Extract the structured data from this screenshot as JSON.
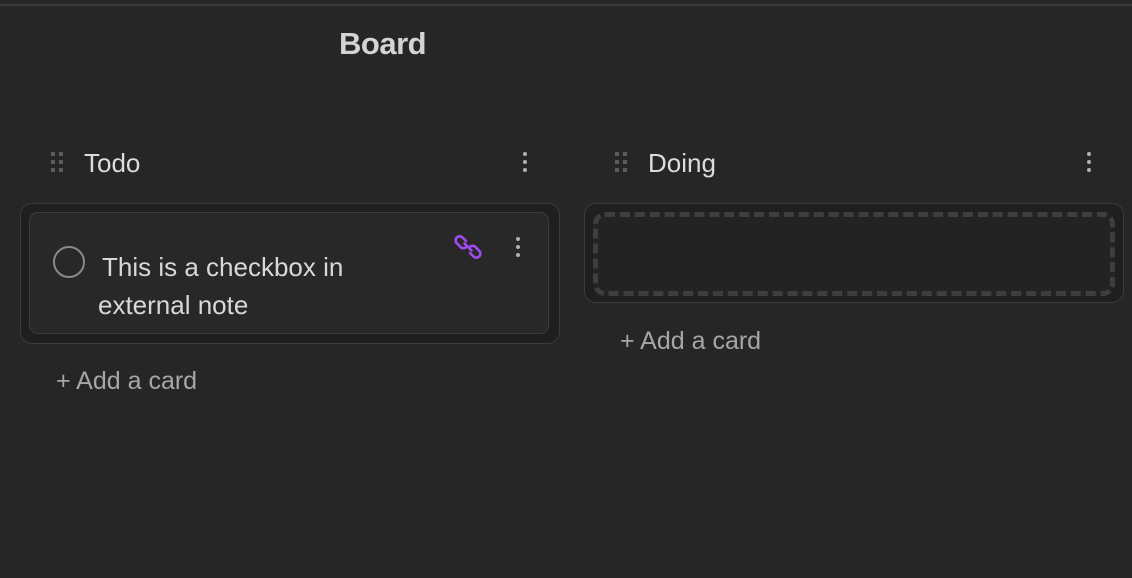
{
  "board": {
    "title": "Board"
  },
  "lanes": [
    {
      "title": "Todo",
      "cards": [
        {
          "text_line1": "This is a checkbox in",
          "text_line2": "external note",
          "checked": false,
          "link_icon": "link-icon"
        }
      ],
      "add_card_label": "+ Add a card"
    },
    {
      "title": "Doing",
      "cards": [],
      "add_card_label": "+ Add a card"
    }
  ],
  "colors": {
    "background": "#262626",
    "link_accent": "#a24bf0",
    "text": "#dcdcdc",
    "muted_text": "#a6a6a6"
  }
}
